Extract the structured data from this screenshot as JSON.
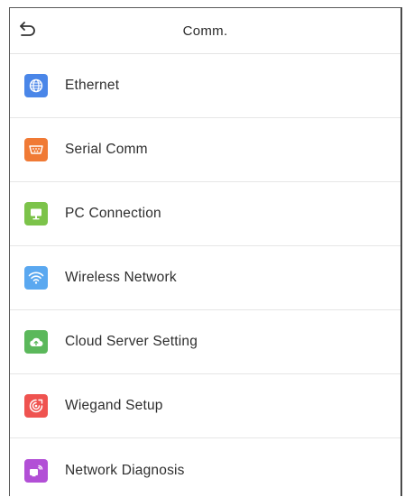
{
  "header": {
    "title": "Comm.",
    "back_icon": "undo-arrow-icon"
  },
  "menu": {
    "items": [
      {
        "label": "Ethernet",
        "icon": "globe-icon",
        "color": "#4a86e8"
      },
      {
        "label": "Serial Comm",
        "icon": "serial-port-icon",
        "color": "#f07a35"
      },
      {
        "label": "PC Connection",
        "icon": "monitor-icon",
        "color": "#7cc34a"
      },
      {
        "label": "Wireless Network",
        "icon": "wifi-icon",
        "color": "#5aa8f0"
      },
      {
        "label": "Cloud Server Setting",
        "icon": "cloud-upload-icon",
        "color": "#5bb85b"
      },
      {
        "label": "Wiegand Setup",
        "icon": "wiegand-icon",
        "color": "#ef5350"
      },
      {
        "label": "Network Diagnosis",
        "icon": "network-diagnosis-icon",
        "color": "#b24fd6"
      }
    ]
  }
}
